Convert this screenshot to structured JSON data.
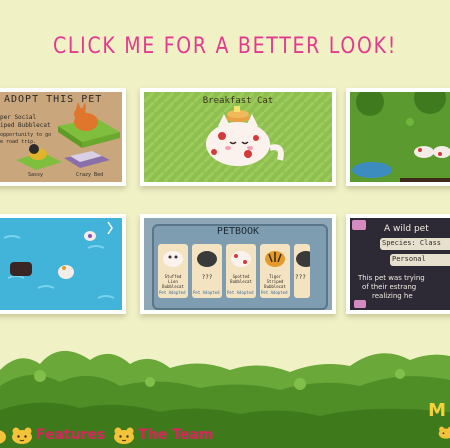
{
  "headline": "CLICK ME FOR A BETTER LOOK!",
  "gallery": {
    "adopt": {
      "title": "ADOPT THIS PET",
      "line1": "per Social",
      "line2": "iped Bubblecat",
      "line3": "opportunity to go",
      "line4": "e road trip.",
      "opt1": "Sassy",
      "opt2": "Crazy Bed"
    },
    "breakfast": {
      "title": "Breakfast Cat"
    },
    "petbook": {
      "title": "PETBOOK",
      "cards": [
        {
          "name": "Stuffed Lion Bubblecat",
          "status": "Pet Adopted"
        },
        {
          "name": "???",
          "status": "Pet Adopted"
        },
        {
          "name": "Spotted Bubblecat",
          "status": "Pet Adopted"
        },
        {
          "name": "Tiger Striped Bubblecat",
          "status": "Pet Adopted"
        },
        {
          "name": "???",
          "status": ""
        }
      ]
    },
    "wild": {
      "title": "A wild pet",
      "species": "Species: Class",
      "personality": "Personal",
      "desc1": "This pet was trying",
      "desc2": "of their estrang",
      "desc3": "realizing he"
    }
  },
  "nav": {
    "features": "Features",
    "team": "The Team",
    "corner": "M"
  },
  "colors": {
    "accent": "#e23a8e",
    "nav": "#d9245e",
    "bg": "#f1f1c6",
    "grass": "#5a9a2c"
  }
}
